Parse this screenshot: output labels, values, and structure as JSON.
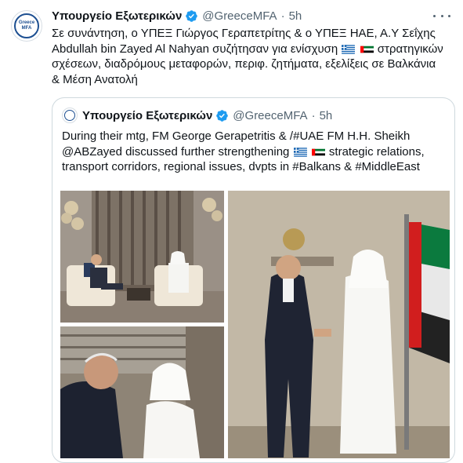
{
  "tweet": {
    "avatar_text_line1": "Greece",
    "avatar_text_line2": "MFA",
    "author_name": "Υπουργείο Εξωτερικών",
    "handle": "@GreeceMFA",
    "separator": "·",
    "time": "5h",
    "verified_icon": "verified-badge-icon",
    "more_icon": "more-options-icon",
    "text_part1": "Σε συνάντηση, ο ΥΠΕΞ Γιώργος Γεραπετρίτης & ο ΥΠΕΞ ΗΑΕ, Α.Υ Σεΐχης Abdullah bin Zayed Al Nahyan συζήτησαν για ενίσχυση ",
    "text_part2": " στρατηγικών σχέσεων, διαδρόμους μεταφορών, περιφ. ζητήματα, εξελίξεις σε Βαλκάνια & Μέση Ανατολή"
  },
  "quoted_tweet": {
    "author_name": "Υπουργείο Εξωτερικών",
    "handle": "@GreeceMFA",
    "separator": "·",
    "time": "5h",
    "text_part1": "During their mtg, FM George Gerapetritis & /#UAE FM H.H. Sheikh @ABZayed discussed further strengthening ",
    "text_part2": " strategic relations, transport corridors, regional issues, dvpts in #Balkans & #MiddleEast",
    "photos": [
      {
        "description_icon": "meeting-seated-photo"
      },
      {
        "description_icon": "handshake-photo"
      },
      {
        "description_icon": "conversation-photo"
      }
    ]
  },
  "colors": {
    "verified_blue": "#1d9bf0",
    "text_primary": "#0f1419",
    "text_secondary": "#536471",
    "border": "#cfd9de",
    "greek_blue": "#0d5eaf",
    "uae_green": "#00732f",
    "uae_red": "#ff0000"
  }
}
